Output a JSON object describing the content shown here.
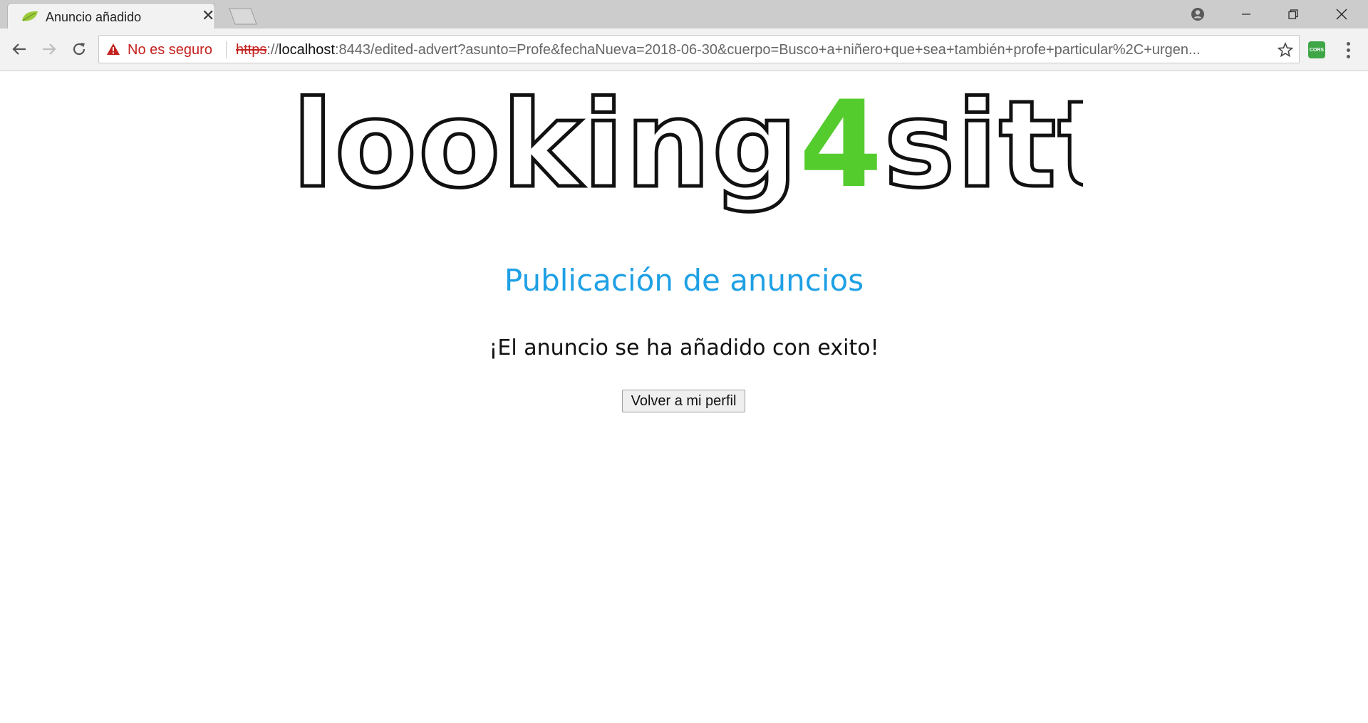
{
  "browser": {
    "tab_title": "Anuncio añadido",
    "security_label": "No es seguro",
    "url_scheme": "https",
    "url_separator": "://",
    "url_host": "localhost",
    "url_rest": ":8443/edited-advert?asunto=Profe&fechaNueva=2018-06-30&cuerpo=Busco+a+niñero+que+sea+también+profe+particular%2C+urgen...",
    "extension_label": "CORS",
    "icons": [
      "favicon-leaf-icon",
      "close-icon",
      "new-tab-icon",
      "profile-icon",
      "minimize-icon",
      "restore-icon",
      "window-close-icon",
      "back-arrow-icon",
      "forward-arrow-icon",
      "reload-icon",
      "warning-icon",
      "bookmark-star-icon",
      "cors-extension-icon",
      "menu-kebab-icon"
    ]
  },
  "colors": {
    "accent": "#1ea0e4",
    "logo_four": "#55cc2e",
    "insecure": "#c5221f"
  },
  "logo": {
    "part1": "looking",
    "part2": "4",
    "part3": "sitter"
  },
  "main": {
    "heading": "Publicación de anuncios",
    "message": "¡El anuncio se ha añadido con exito!",
    "back_button": "Volver a mi perfil"
  }
}
